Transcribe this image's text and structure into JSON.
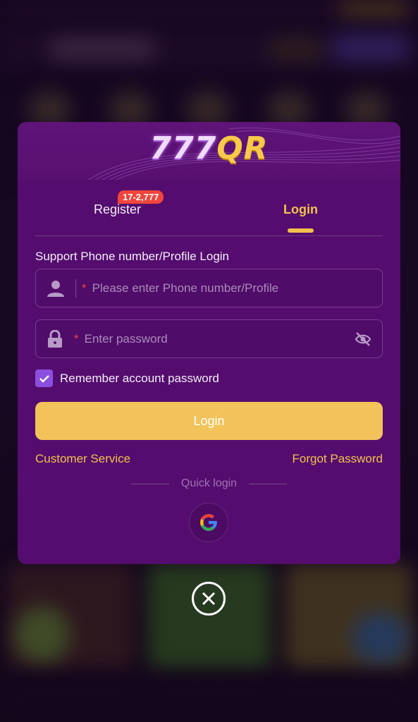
{
  "brand": {
    "part1": "777",
    "part2": "QR"
  },
  "tabs": {
    "register_label": "Register",
    "register_badge": "17-2,777",
    "login_label": "Login"
  },
  "form": {
    "support_label": "Support Phone number/Profile Login",
    "phone_placeholder": "Please enter Phone number/Profile",
    "password_placeholder": "Enter password",
    "required_mark": "*",
    "remember_label": "Remember account password",
    "remember_checked": true,
    "login_button": "Login"
  },
  "links": {
    "customer_service": "Customer Service",
    "forgot_password": "Forgot Password"
  },
  "quick_login": {
    "label": "Quick login",
    "providers": [
      "google-icon"
    ]
  },
  "icons": {
    "user": "user-icon",
    "lock": "lock-icon",
    "eye": "eye-off-icon",
    "close": "close-icon"
  },
  "colors": {
    "modal_bg": "#540d6e",
    "accent_gold": "#f2c14e",
    "button_gold": "#f2c35a",
    "badge_red": "#f0443c",
    "checkbox_purple": "#8b4fe0"
  }
}
